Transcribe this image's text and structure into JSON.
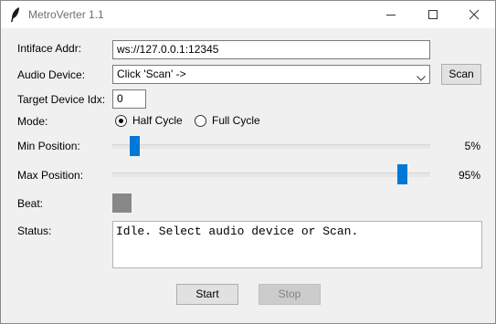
{
  "window": {
    "title": "MetroVerter 1.1"
  },
  "form": {
    "interface_label": "Intiface Addr:",
    "interface_value": "ws://127.0.0.1:12345",
    "audio_label": "Audio Device:",
    "audio_value": "Click 'Scan' ->",
    "scan_label": "Scan",
    "target_label": "Target Device Idx:",
    "target_value": "0",
    "mode_label": "Mode:",
    "mode_options": [
      "Half Cycle",
      "Full Cycle"
    ],
    "mode_selected": "Half Cycle",
    "min_label": "Min Position:",
    "min_value": 5,
    "min_text": "5%",
    "max_label": "Max Position:",
    "max_value": 95,
    "max_text": "95%",
    "beat_label": "Beat:",
    "beat_color": "#888888",
    "status_label": "Status:",
    "status_text": "Idle. Select audio device or Scan."
  },
  "buttons": {
    "start": "Start",
    "stop": "Stop"
  },
  "colors": {
    "accent": "#0078d7",
    "background": "#f0f0f0"
  }
}
